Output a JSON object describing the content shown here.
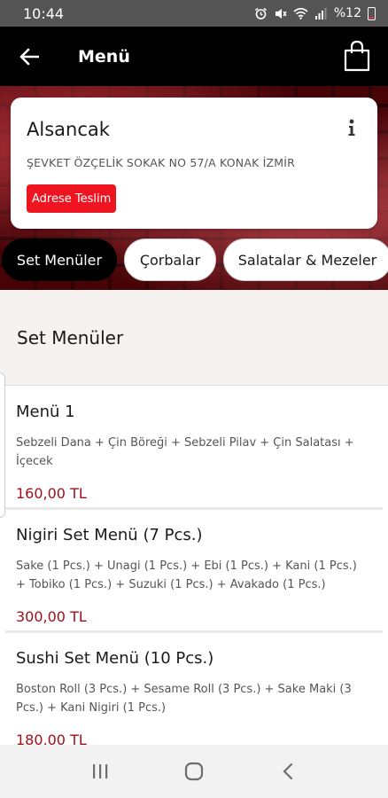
{
  "status_bar": {
    "time": "10:44",
    "battery": "%12",
    "icons": [
      "alarm-icon",
      "mute-icon",
      "wifi-icon",
      "signal-icon",
      "battery-icon"
    ]
  },
  "app_bar": {
    "title": "Menü",
    "back_icon": "back-arrow-icon",
    "cart_icon": "shopping-bag-icon"
  },
  "store": {
    "name": "Alsancak",
    "address": "ŞEVKET ÖZÇELİK SOKAK NO 57/A KONAK İZMİR",
    "delivery_button": "Adrese Teslim",
    "info_icon": "info-icon"
  },
  "tabs": [
    {
      "label": "Set Menüler",
      "active": true
    },
    {
      "label": "Çorbalar",
      "active": false
    },
    {
      "label": "Salatalar & Mezeler",
      "active": false
    }
  ],
  "section": {
    "title": "Set Menüler"
  },
  "items": [
    {
      "name": "Menü 1",
      "description": "Sebzeli Dana + Çin Böreği + Sebzeli Pilav + Çin Salatası + İçecek",
      "price": "160,00 TL"
    },
    {
      "name": "Nigiri Set Menü (7 Pcs.)",
      "description": "Sake (1 Pcs.) + Unagi (1 Pcs.) + Ebi (1 Pcs.) + Kani (1 Pcs.) + Tobiko (1 Pcs.) + Suzuki (1 Pcs.) + Avakado (1 Pcs.)",
      "price": "300,00 TL"
    },
    {
      "name": "Sushi Set Menü (10 Pcs.)",
      "description": "Boston Roll (3 Pcs.) + Sesame Roll (3 Pcs.) + Sake Maki (3 Pcs.) + Kani Nigiri (1 Pcs.)",
      "price": "180,00 TL"
    }
  ],
  "nav_bar": {
    "recents_icon": "recents-icon",
    "home_icon": "home-icon",
    "back_icon": "nav-back-icon"
  },
  "colors": {
    "accent_red": "#ee1520",
    "price_red": "#a00f1a",
    "app_bar": "#000000"
  }
}
